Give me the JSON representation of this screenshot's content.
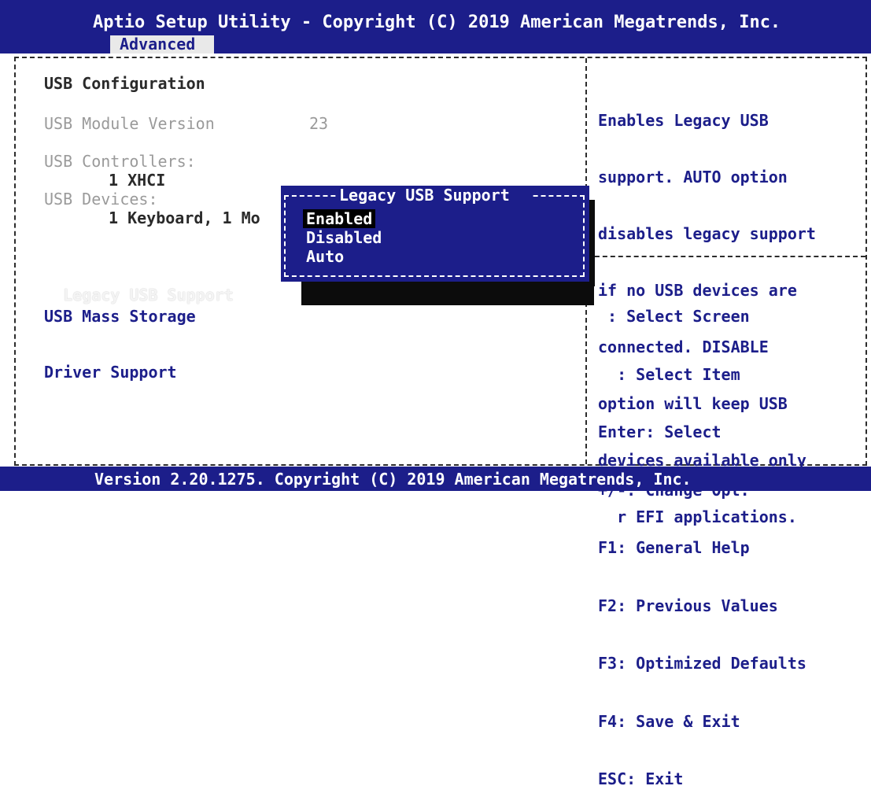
{
  "header": {
    "title": "Aptio Setup Utility - Copyright (C) 2019 American Megatrends, Inc.",
    "active_tab": "Advanced"
  },
  "main": {
    "section_title": "USB Configuration",
    "module_version_label": "USB Module Version",
    "module_version_value": "23",
    "controllers_label": "USB Controllers:",
    "controllers_value": "1 XHCI",
    "devices_label": "USB Devices:",
    "devices_value": "1 Keyboard, 1 Mo",
    "legacy_support_label": "Legacy USB Support",
    "mass_storage_label_1": "USB Mass Storage",
    "mass_storage_label_2": "Driver Support"
  },
  "popup": {
    "title": "Legacy USB Support",
    "options": [
      "Enabled",
      "Disabled",
      "Auto"
    ],
    "selected": "Enabled"
  },
  "help": {
    "lines": [
      "Enables Legacy USB",
      "support. AUTO option",
      "disables legacy support",
      "if no USB devices are",
      "connected. DISABLE",
      "option will keep USB",
      "devices available only",
      "  r EFI applications."
    ]
  },
  "keys": {
    "lines": [
      " : Select Screen",
      "  : Select Item",
      "Enter: Select",
      "+/-: Change Opt.",
      "F1: General Help",
      "F2: Previous Values",
      "F3: Optimized Defaults",
      "F4: Save & Exit",
      "ESC: Exit"
    ]
  },
  "footer": {
    "text": "Version 2.20.1275. Copyright (C) 2019 American Megatrends, Inc."
  },
  "colors": {
    "bios_blue": "#1c1e8a",
    "background": "#ffffff",
    "highlight": "#000000"
  }
}
